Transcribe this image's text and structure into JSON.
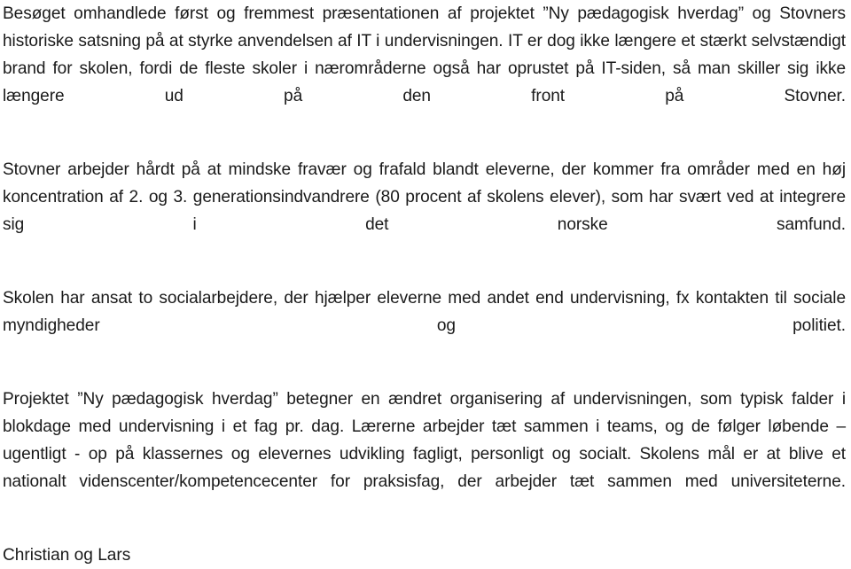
{
  "document": {
    "background_color": "#ffffff",
    "text_color": "#1a1a1a",
    "language": "da",
    "paragraphs": [
      {
        "id": "p1",
        "text": "Besøget omhandlede først og fremmest præsentationen af  projektet ”Ny pædagogisk hverdag” og Stovners historiske satsning på at styrke anvendelsen af IT i undervisningen. IT er dog ikke længere et stærkt selvstændigt brand for skolen, fordi de fleste skoler i nærområderne også har oprustet på IT-siden, så man skiller sig ikke længere ud på den front på Stovner.",
        "lines": [
          "Besøget omhandlede først og fremmest præsentationen af  projektet ”Ny pædagogisk hverdag” og",
          "Stovners historiske satsning på at styrke anvendelsen af IT i undervisningen. IT er dog ikke længere et",
          "stærkt selvstændigt brand for skolen, fordi de fleste skoler i nærområderne også har oprustet på IT-",
          "siden, så man skiller sig ikke længere ud på den front på Stovner."
        ]
      },
      {
        "id": "p2",
        "text": "Stovner arbejder hårdt på at mindske fravær og frafald blandt eleverne, der kommer fra områder med en høj koncentration af 2. og 3. generationsindvandrere (80 procent af skolens elever), som har svært ved at integrere sig i det norske samfund.",
        "lines": [
          "Stovner arbejder hårdt på at mindske fravær og frafald blandt eleverne, der kommer fra områder med",
          "en høj koncentration af 2. og 3. generationsindvandrere (80 procent af skolens elever), som har svært",
          "ved at integrere sig i det norske samfund."
        ]
      },
      {
        "id": "p3",
        "text": "Skolen har ansat to socialarbejdere, der hjælper eleverne med andet end undervisning, fx kontakten til sociale myndigheder og politiet.",
        "lines": [
          "Skolen har ansat to socialarbejdere, der hjælper eleverne med andet end undervisning, fx kontakten til",
          "sociale myndigheder og politiet."
        ]
      },
      {
        "id": "p4",
        "text": "Projektet ”Ny pædagogisk hverdag” betegner en ændret organisering af undervisningen, som typisk falder i blokdage med undervisning i et fag pr. dag. Lærerne arbejder tæt sammen i teams, og de følger løbende – ugentligt - op på klassernes og elevernes udvikling fagligt, personligt og socialt. Skolens mål er at blive et nationalt videnscenter/kompetencecenter for praksisfag, der arbejder tæt sammen med universiteterne.",
        "lines": [
          "Projektet ”Ny pædagogisk hverdag” betegner en ændret organisering af undervisningen, som typisk",
          "falder i blokdage med undervisning i et fag pr. dag. Lærerne arbejder tæt sammen i teams, og de følger",
          "løbende – ugentligt - op på klassernes og elevernes udvikling fagligt, personligt og socialt.",
          "Skolens mål er at blive et nationalt videnscenter/kompetencecenter for praksisfag, der arbejder tæt",
          "sammen med universiteterne."
        ]
      }
    ],
    "signature": "Christian og Lars"
  }
}
